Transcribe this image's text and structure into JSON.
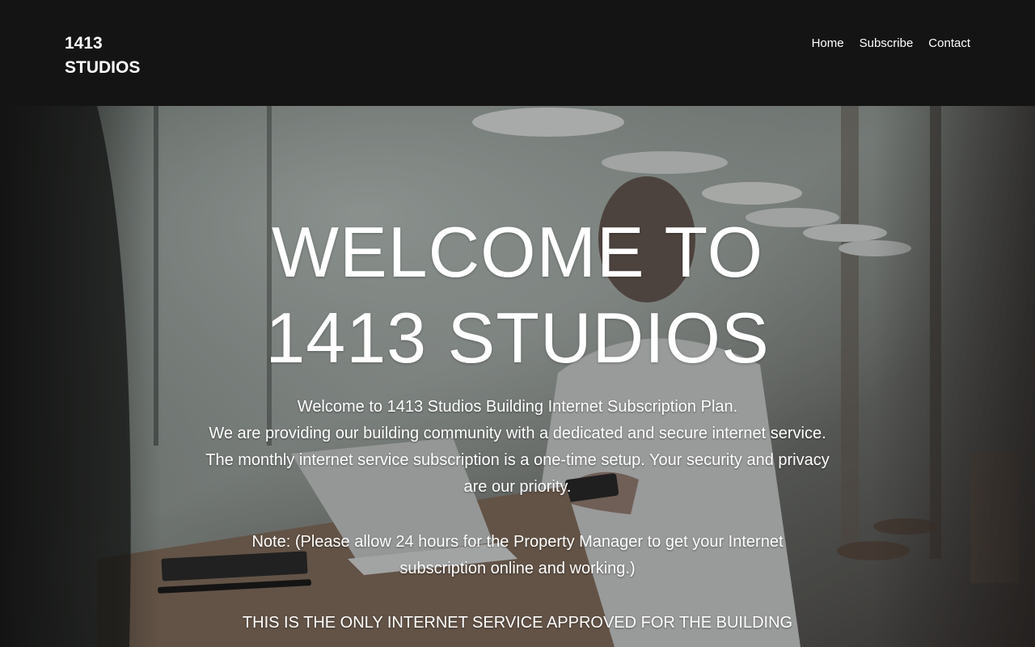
{
  "header": {
    "logo_line1": "1413",
    "logo_line2": "STUDIOS",
    "nav": [
      {
        "label": "Home"
      },
      {
        "label": "Subscribe"
      },
      {
        "label": "Contact"
      }
    ]
  },
  "hero": {
    "title_line1": "WELCOME TO",
    "title_line2": "1413 STUDIOS",
    "intro_lines": [
      "Welcome to 1413 Studios Building Internet Subscription Plan.",
      "We are providing our building community with a dedicated and secure internet service.",
      "The monthly internet service subscription is a one-time setup. Your security and privacy",
      "are our priority."
    ],
    "note_lines": [
      "Note: (Please allow 24 hours for the Property Manager to get your Internet",
      "subscription online and working.)"
    ],
    "approval": "THIS IS THE ONLY INTERNET SERVICE APPROVED FOR THE BUILDING"
  },
  "colors": {
    "header_bg": "#141414",
    "text": "#ffffff"
  }
}
